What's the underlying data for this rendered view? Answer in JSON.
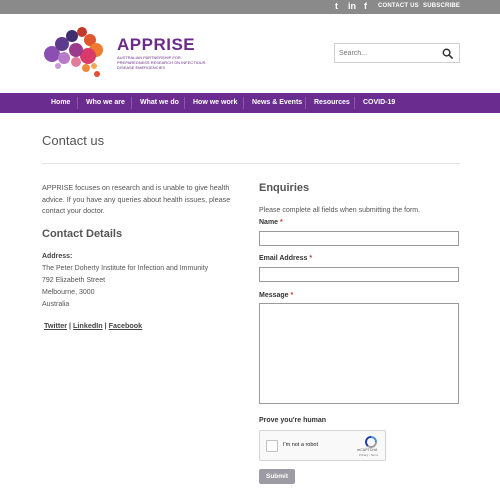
{
  "topbar": {
    "social": [
      "twitter-icon",
      "linkedin-icon",
      "facebook-icon"
    ],
    "social_glyphs": [
      "t",
      "in",
      "f"
    ],
    "contact_label": "CONTACT US",
    "subscribe_label": "SUBSCRIBE"
  },
  "header": {
    "brand": "APPRISE",
    "tagline": "Australian Partnership for Preparedness Research on Infectious Disease Emergencies",
    "search_placeholder": "Search..."
  },
  "nav": {
    "items": [
      "Home",
      "Who we are",
      "What we do",
      "How we work",
      "News & Events",
      "Resources",
      "COVID-19"
    ]
  },
  "page": {
    "title": "Contact us"
  },
  "left": {
    "intro": "APPRISE focuses on research and is unable to give health advice. If you have any queries about health issues, please contact your doctor.",
    "contact_title": "Contact Details",
    "address_label": "Address:",
    "address_lines": [
      "The Peter Doherty Institute for Infection and Immunity",
      "792 Elizabeth Street",
      "Melbourne, 3000",
      "Australia"
    ],
    "links": [
      "Twitter",
      "LinkedIn",
      "Facebook"
    ],
    "separator": "|"
  },
  "form": {
    "title": "Enquiries",
    "note": "Please complete all fields when submitting the form.",
    "name_label": "Name",
    "email_label": "Email Address",
    "message_label": "Message",
    "required_mark": "*",
    "prove_label": "Prove you're human",
    "captcha_label": "I'm not a robot",
    "captcha_brand": "reCAPTCHA",
    "captcha_terms": "Privacy - Terms",
    "submit_label": "Submit"
  },
  "colors": {
    "topbar": "#8a8a8a",
    "nav": "#6a2c8e",
    "brand": "#6b2b8a",
    "submit": "#9d9ba3"
  }
}
